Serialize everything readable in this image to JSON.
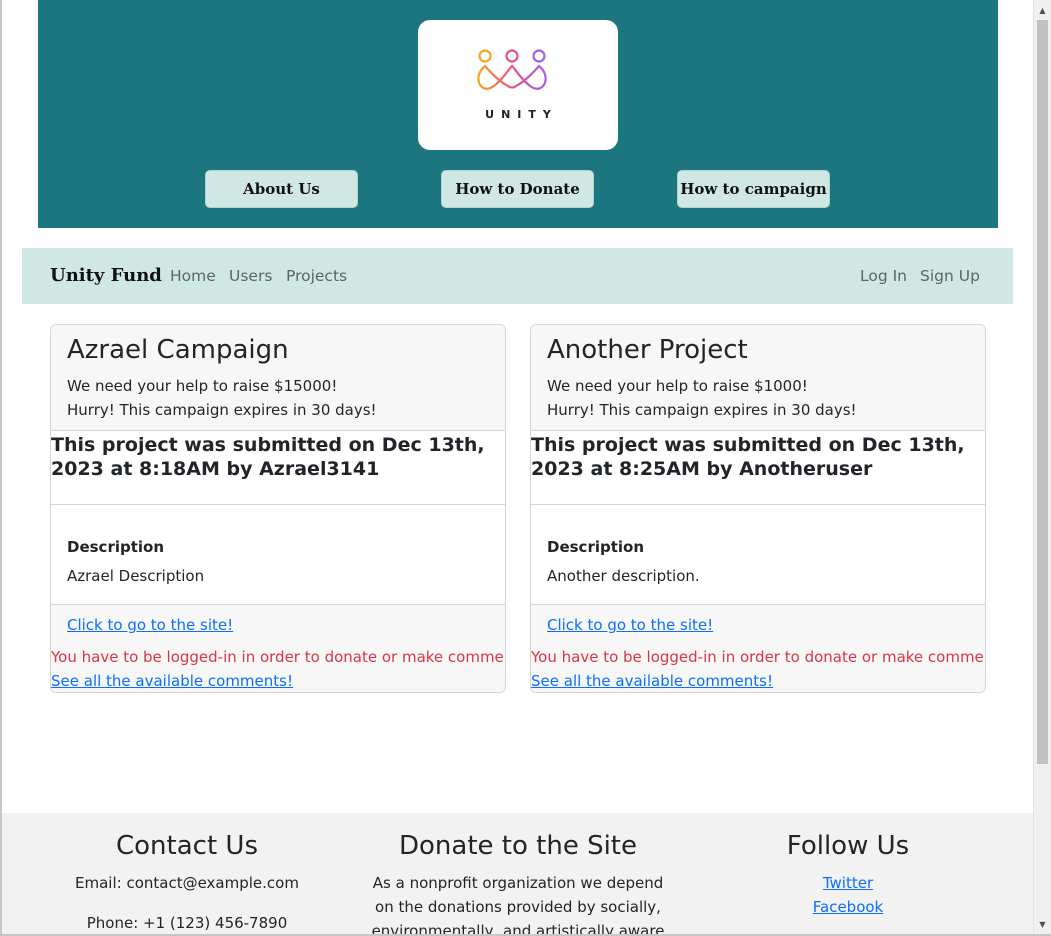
{
  "header": {
    "logo_text": "UNITY",
    "buttons": [
      "About Us",
      "How to Donate",
      "How to campaign"
    ]
  },
  "navbar": {
    "brand": "Unity Fund",
    "links": [
      "Home",
      "Users",
      "Projects"
    ],
    "auth": [
      "Log In",
      "Sign Up"
    ]
  },
  "cards": [
    {
      "title": "Azrael Campaign",
      "goal": "We need your help to raise $15000!",
      "expire": "Hurry! This campaign expires in 30 days!",
      "submitted": "This project was submitted on Dec 13th, 2023 at 8:18AM by Azrael3141",
      "desc_label": "Description",
      "desc": "Azrael Description",
      "site_link": "Click to go to the site!",
      "login_warning": "You have to be logged-in in order to donate or make comments",
      "comments_link": "See all the available comments!"
    },
    {
      "title": "Another Project",
      "goal": "We need your help to raise $1000!",
      "expire": "Hurry! This campaign expires in 30 days!",
      "submitted": "This project was submitted on Dec 13th, 2023 at 8:25AM by Anotheruser",
      "desc_label": "Description",
      "desc": "Another description.",
      "site_link": "Click to go to the site!",
      "login_warning": "You have to be logged-in in order to donate or make comments",
      "comments_link": "See all the available comments!"
    }
  ],
  "footer": {
    "contact": {
      "heading": "Contact Us",
      "email": "Email: contact@example.com",
      "phone": "Phone: +1 (123) 456-7890"
    },
    "donate": {
      "heading": "Donate to the Site",
      "text": "As a nonprofit organization we depend on the donations provided by socially, environmentally, and artistically aware"
    },
    "follow": {
      "heading": "Follow Us",
      "links": [
        "Twitter",
        "Facebook"
      ]
    }
  },
  "colors": {
    "header_bg": "#1c7680",
    "nav_bg": "#d0e8e3",
    "link": "#0d6efd",
    "warning": "#dc3545"
  }
}
